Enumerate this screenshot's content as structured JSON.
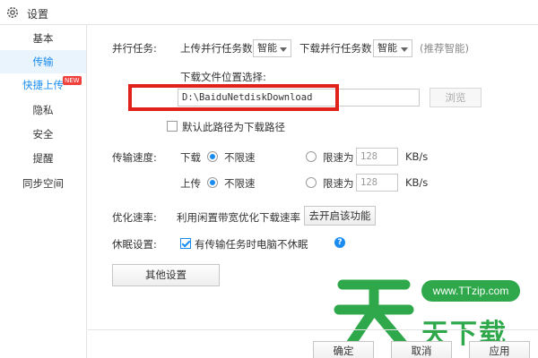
{
  "window": {
    "title": "设置"
  },
  "sidebar": {
    "items": [
      {
        "label": "基本"
      },
      {
        "label": "传输"
      },
      {
        "label": "快捷上传",
        "badge": "NEW"
      },
      {
        "label": "隐私"
      },
      {
        "label": "安全"
      },
      {
        "label": "提醒"
      },
      {
        "label": "同步空间"
      }
    ],
    "active_index": 1
  },
  "parallel": {
    "label": "并行任务:",
    "upload_label": "上传并行任务数",
    "upload_value": "智能",
    "download_label": "下载并行任务数",
    "download_value": "智能",
    "hint": "(推荐智能)"
  },
  "download_path": {
    "label": "下载文件位置选择:",
    "value": "D:\\BaiduNetdiskDownload",
    "browse_label": "浏览",
    "default_checkbox_label": "默认此路径为下载路径",
    "default_checked": false
  },
  "speed": {
    "label": "传输速度:",
    "download": {
      "label": "下载",
      "unlimited_label": "不限速",
      "limit_label": "限速为",
      "limit_value": "128",
      "unit": "KB/s",
      "selected": "unlimited"
    },
    "upload": {
      "label": "上传",
      "unlimited_label": "不限速",
      "limit_label": "限速为",
      "limit_value": "128",
      "unit": "KB/s",
      "selected": "unlimited"
    }
  },
  "optimize": {
    "label": "优化速率:",
    "description": "利用闲置带宽优化下载速率",
    "button_label": "去开启该功能"
  },
  "sleep": {
    "label": "休眠设置:",
    "checkbox_label": "有传输任务时电脑不休眠",
    "checked": true,
    "help_icon": "?"
  },
  "other_settings_label": "其他设置",
  "footer": {
    "ok_label": "确定",
    "cancel_label": "取消",
    "apply_label": "应用"
  },
  "watermark": {
    "site": "www.TTzip.com",
    "text": "天下载",
    "color": "#2ea84a"
  },
  "colors": {
    "accent": "#1a8cf0",
    "highlight": "#e0221a",
    "badge": "#f2403c"
  }
}
